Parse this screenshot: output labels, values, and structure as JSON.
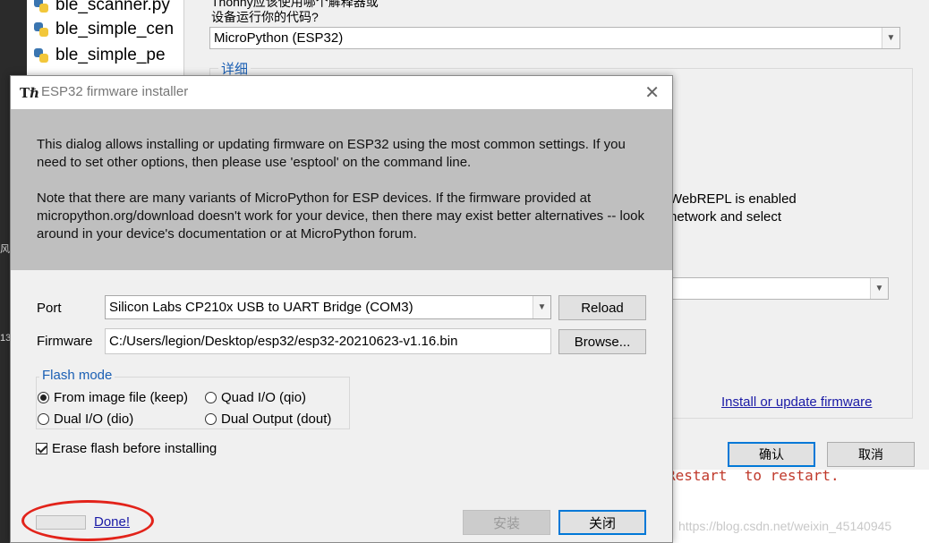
{
  "file_tree": {
    "items": [
      {
        "label": "ble_scanner.py",
        "icon": "python-file-icon"
      },
      {
        "label": "ble_simple_cen",
        "icon": "python-file-icon"
      },
      {
        "label": "ble_simple_pe",
        "icon": "python-file-icon"
      }
    ],
    "gutter": [
      "风",
      "13"
    ]
  },
  "options_dialog": {
    "description": "Thonny应该使用哪个解释器或",
    "question": "设备运行你的代码?",
    "interpreter_value": "MicroPython (ESP32)",
    "details_legend": "详细",
    "webrepl_line1": "WebREPL is enabled",
    "webrepl_line2": "network and select",
    "install_link": "Install or update firmware",
    "ok_label": "确认",
    "cancel_label": "取消"
  },
  "console": {
    "text": "Restart  to restart."
  },
  "watermark": "https://blog.csdn.net/weixin_45140945",
  "installer": {
    "title": "ESP32 firmware installer",
    "intro_p1": "This dialog allows installing or updating firmware on ESP32 using the most common settings. If you need to set other options, then please use 'esptool' on the command line.",
    "intro_p2": "Note that there are many variants of MicroPython for ESP devices. If the firmware provided at micropython.org/download doesn't work for your device, then there may exist better alternatives -- look around in your device's documentation or at MicroPython forum.",
    "port_label": "Port",
    "port_value": "Silicon Labs CP210x USB to UART Bridge (COM3)",
    "reload_label": "Reload",
    "firmware_label": "Firmware",
    "firmware_value": "C:/Users/legion/Desktop/esp32/esp32-20210623-v1.16.bin",
    "browse_label": "Browse...",
    "flash_mode_legend": "Flash mode",
    "flash_modes": [
      {
        "label": "From image file (keep)",
        "selected": true
      },
      {
        "label": "Quad I/O (qio)",
        "selected": false
      },
      {
        "label": "Dual I/O (dio)",
        "selected": false
      },
      {
        "label": "Dual Output (dout)",
        "selected": false
      }
    ],
    "erase_label": "Erase flash before installing",
    "erase_checked": true,
    "progress_fraction": 0,
    "done_label": "Done!",
    "install_label": "安装",
    "close_label": "关闭"
  },
  "colors": {
    "link": "#1a1aa6",
    "legend": "#1a5fb4",
    "annotation_circle": "#e2231a",
    "focus_border": "#0078d7"
  }
}
